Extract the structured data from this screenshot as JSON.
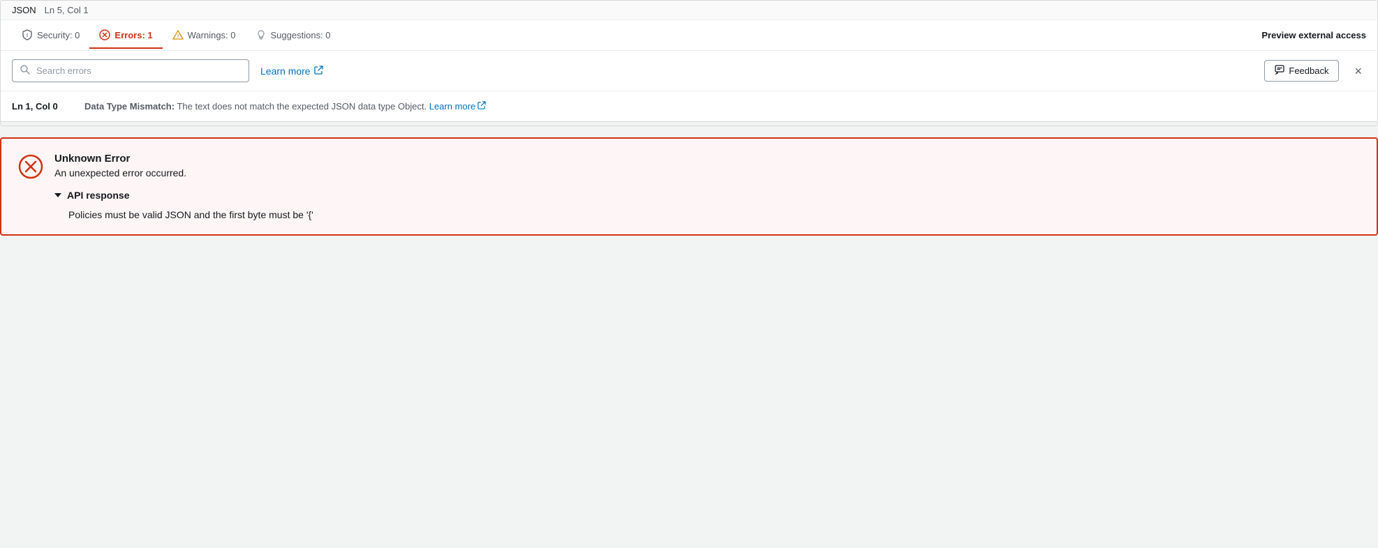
{
  "editor": {
    "status_bar": {
      "language": "JSON",
      "position": "Ln 5, Col 1"
    },
    "tabs": [
      {
        "id": "security",
        "label": "Security: 0",
        "active": false,
        "icon": "shield"
      },
      {
        "id": "errors",
        "label": "Errors: 1",
        "active": true,
        "icon": "error-circle"
      },
      {
        "id": "warnings",
        "label": "Warnings: 0",
        "active": false,
        "icon": "warning-triangle"
      },
      {
        "id": "suggestions",
        "label": "Suggestions: 0",
        "active": false,
        "icon": "lightbulb"
      }
    ],
    "preview_label": "Preview external access",
    "search": {
      "placeholder": "Search errors",
      "value": ""
    },
    "learn_more_label": "Learn more",
    "feedback_label": "Feedback",
    "close_label": "×",
    "error_entries": [
      {
        "location": "Ln 1, Col 0",
        "type": "Data Type Mismatch:",
        "message": " The text does not match the expected JSON data type Object.",
        "learn_more": "Learn more"
      }
    ]
  },
  "error_panel": {
    "title": "Unknown Error",
    "description": "An unexpected error occurred.",
    "api_response_label": "API response",
    "api_response_body": "Policies must be valid JSON and the first byte must be '{'"
  },
  "colors": {
    "error_red": "#d13212",
    "link_blue": "#0073bb",
    "text_muted": "#545b64"
  }
}
